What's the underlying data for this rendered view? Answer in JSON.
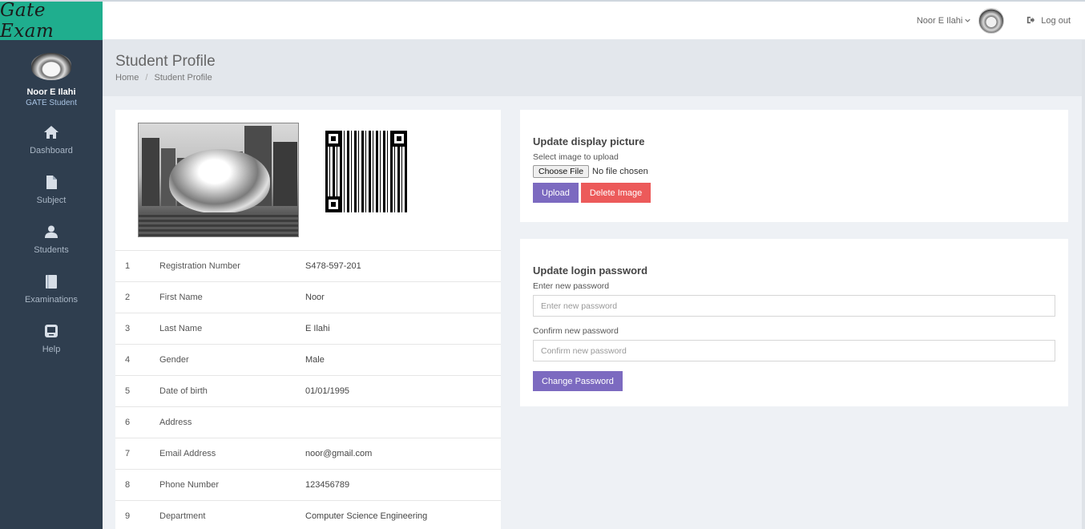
{
  "brand": {
    "logo_text": "Gate Exam"
  },
  "topbar": {
    "user_name": "Noor E Ilahi",
    "logout_label": "Log out"
  },
  "sidebar": {
    "user_name": "Noor E Ilahi",
    "user_role": "GATE Student",
    "items": [
      {
        "label": "Dashboard",
        "icon": "home-icon"
      },
      {
        "label": "Subject",
        "icon": "file-icon"
      },
      {
        "label": "Students",
        "icon": "user-icon"
      },
      {
        "label": "Examinations",
        "icon": "book-icon"
      },
      {
        "label": "Help",
        "icon": "help-icon"
      }
    ]
  },
  "page": {
    "title": "Student Profile",
    "breadcrumb": [
      "Home",
      "Student Profile"
    ]
  },
  "profile": {
    "rows": [
      {
        "num": "1",
        "label": "Registration Number",
        "value": "S478-597-201"
      },
      {
        "num": "2",
        "label": "First Name",
        "value": "Noor"
      },
      {
        "num": "3",
        "label": "Last Name",
        "value": "E Ilahi"
      },
      {
        "num": "4",
        "label": "Gender",
        "value": "Male"
      },
      {
        "num": "5",
        "label": "Date of birth",
        "value": "01/01/1995"
      },
      {
        "num": "6",
        "label": "Address",
        "value": ""
      },
      {
        "num": "7",
        "label": "Email Address",
        "value": "noor@gmail.com"
      },
      {
        "num": "8",
        "label": "Phone Number",
        "value": "123456789"
      },
      {
        "num": "9",
        "label": "Department",
        "value": "Computer Science Engineering"
      }
    ]
  },
  "display_picture": {
    "title": "Update display picture",
    "select_label": "Select image to upload",
    "choose_file_label": "Choose File",
    "no_file_text": "No file chosen",
    "upload_label": "Upload",
    "delete_label": "Delete Image"
  },
  "password": {
    "title": "Update login password",
    "new_label": "Enter new password",
    "new_placeholder": "Enter new password",
    "confirm_label": "Confirm new password",
    "confirm_placeholder": "Confirm new password",
    "submit_label": "Change Password"
  }
}
